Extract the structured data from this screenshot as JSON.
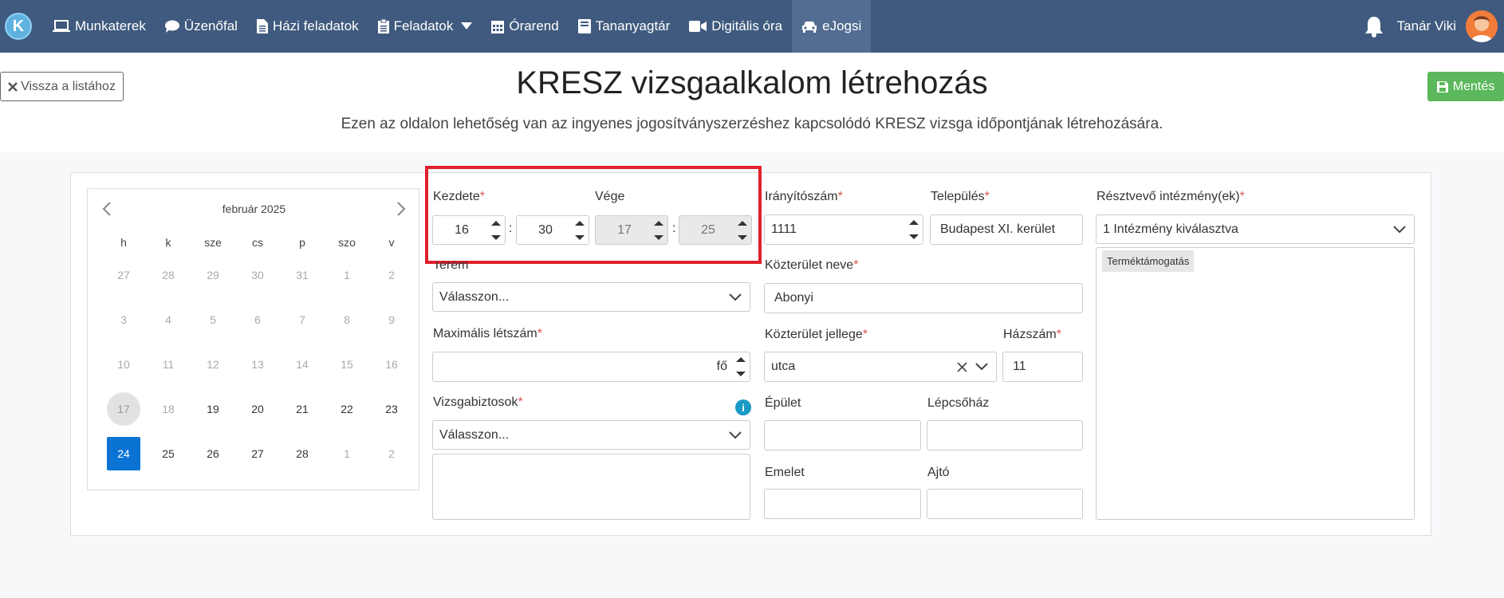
{
  "nav": {
    "logo_letter": "K",
    "items": [
      {
        "label": "Munkaterek",
        "icon": "laptop-icon"
      },
      {
        "label": "Üzenőfal",
        "icon": "comment-icon"
      },
      {
        "label": "Házi feladatok",
        "icon": "file-icon"
      },
      {
        "label": "Feladatok",
        "icon": "clipboard-icon"
      },
      {
        "label": "Órarend",
        "icon": "calendar-icon"
      },
      {
        "label": "Tananyagtár",
        "icon": "book-icon"
      },
      {
        "label": "Digitális óra",
        "icon": "video-icon"
      },
      {
        "label": "eJogsi",
        "icon": "car-icon"
      }
    ],
    "user_name": "Tanár Viki"
  },
  "header": {
    "back_label": "Vissza a listához",
    "title": "KRESZ vizsgaalkalom létrehozás",
    "subtitle": "Ezen az oldalon lehetőség van az ingyenes jogosítványszerzéshez kapcsolódó KRESZ vizsga időpontjának létrehozására.",
    "save_label": "Mentés"
  },
  "calendar": {
    "month": "február 2025",
    "weekdays": [
      "h",
      "k",
      "sze",
      "cs",
      "p",
      "szo",
      "v"
    ],
    "days": [
      [
        "27",
        "28",
        "29",
        "30",
        "31",
        "1",
        "2"
      ],
      [
        "3",
        "4",
        "5",
        "6",
        "7",
        "8",
        "9"
      ],
      [
        "10",
        "11",
        "12",
        "13",
        "14",
        "15",
        "16"
      ],
      [
        "17",
        "18",
        "19",
        "20",
        "21",
        "22",
        "23"
      ],
      [
        "24",
        "25",
        "26",
        "27",
        "28",
        "1",
        "2"
      ]
    ]
  },
  "form": {
    "start_label": "Kezdete",
    "end_label": "Vége",
    "start_hour": "16",
    "start_min": "30",
    "end_hour": "17",
    "end_min": "25",
    "room_label": "Terem",
    "room_placeholder": "Válasszon...",
    "max_label": "Maximális létszám",
    "max_unit": "fő",
    "examiners_label": "Vizsgabiztosok",
    "examiners_placeholder": "Válasszon...",
    "zip_label": "Irányítószám",
    "zip_value": "1111",
    "city_label": "Település",
    "city_value": "Budapest XI. kerület",
    "street_label": "Közterület neve",
    "street_value": "Abonyi",
    "street_type_label": "Közterület jellege",
    "street_type_value": "utca",
    "house_label": "Házszám",
    "house_value": "11",
    "building_label": "Épület",
    "stair_label": "Lépcsőház",
    "floor_label": "Emelet",
    "door_label": "Ajtó",
    "inst_label": "Résztvevő intézmény(ek)",
    "inst_value": "1 Intézmény kiválasztva",
    "inst_tag": "Terméktámogatás",
    "req_mark": "*"
  }
}
